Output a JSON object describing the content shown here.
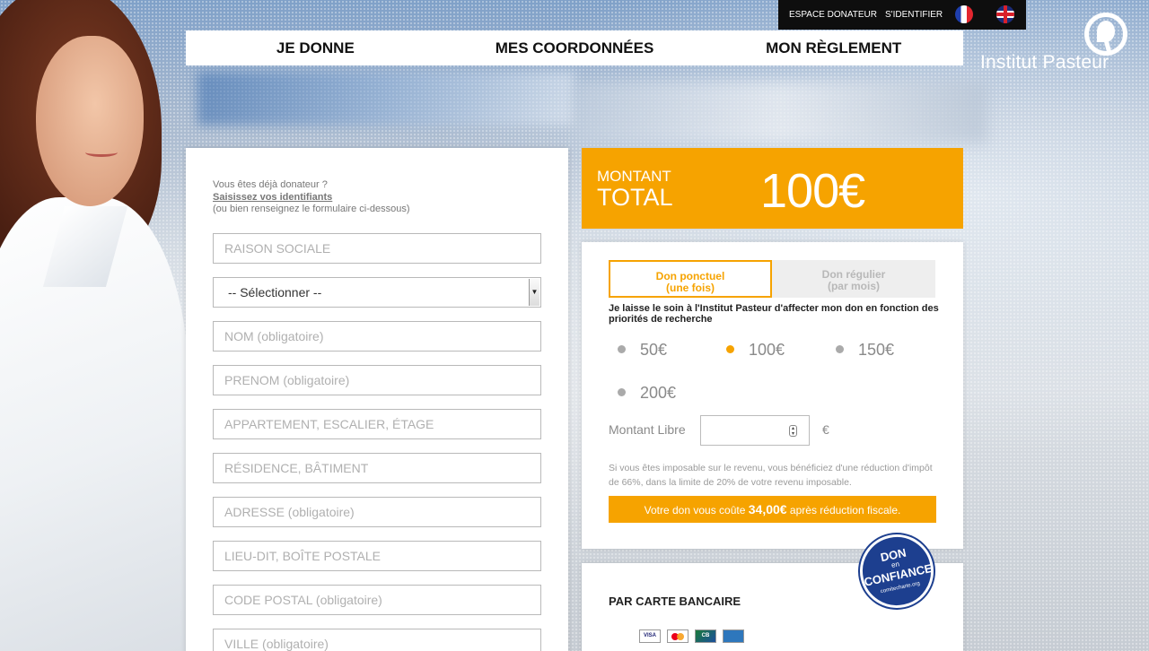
{
  "topbar": {
    "espace_donateur": "ESPACE DONATEUR",
    "sidentifier": "S'IDENTIFIER"
  },
  "logo": {
    "text": "Institut Pasteur"
  },
  "steps": [
    "JE DONNE",
    "MES COORDONNÉES",
    "MON RÈGLEMENT"
  ],
  "form": {
    "already_line1": "Vous êtes déjà donateur ?",
    "already_link": "Saisissez vos identifiants",
    "already_line3": "(ou bien renseignez le formulaire ci-dessous)",
    "raison_sociale": "RAISON SOCIALE",
    "select_value": "-- Sélectionner --",
    "nom": "NOM (obligatoire)",
    "prenom": "PRENOM (obligatoire)",
    "appartement": "APPARTEMENT, ESCALIER, ÉTAGE",
    "residence": "RÉSIDENCE, BÂTIMENT",
    "adresse": "ADRESSE (obligatoire)",
    "lieu_dit": "LIEU-DIT, BOÎTE POSTALE",
    "code_postal": "CODE POSTAL (obligatoire)",
    "ville": "VILLE (obligatoire)"
  },
  "amount": {
    "label1": "MONTANT",
    "label2": "TOTAL",
    "value": "100€"
  },
  "donation": {
    "tab_ponctuel_1": "Don ponctuel",
    "tab_ponctuel_2": "(une fois)",
    "tab_regulier_1": "Don régulier",
    "tab_regulier_2": "(par mois)",
    "affect_text": "Je laisse le soin à l'Institut Pasteur d'affecter mon don en fonction des priorités de recherche",
    "options": [
      "50€",
      "100€",
      "150€",
      "200€"
    ],
    "selected_option": "100€",
    "libre_label": "Montant Libre",
    "libre_value": "",
    "euro_sign": "€",
    "fiscal_text": "Si vous êtes imposable sur le revenu, vous bénéficiez d'une réduction d'impôt de 66%, dans la limite de 20% de votre revenu imposable.",
    "cost_prefix": "Votre don vous coûte",
    "cost_amount": "34,00€",
    "cost_suffix": "après réduction fiscale."
  },
  "payment": {
    "title": "PAR CARTE BANCAIRE",
    "cards": [
      "VISA",
      "MC",
      "CB",
      "AMEX"
    ]
  },
  "seal": {
    "line1": "DON",
    "line2": "en",
    "line3": "CONFIANCE",
    "line4": "comitecharte.org"
  },
  "colors": {
    "accent": "#f6a300",
    "seal": "#1d3f8f",
    "topbar": "#0e0e0e"
  }
}
